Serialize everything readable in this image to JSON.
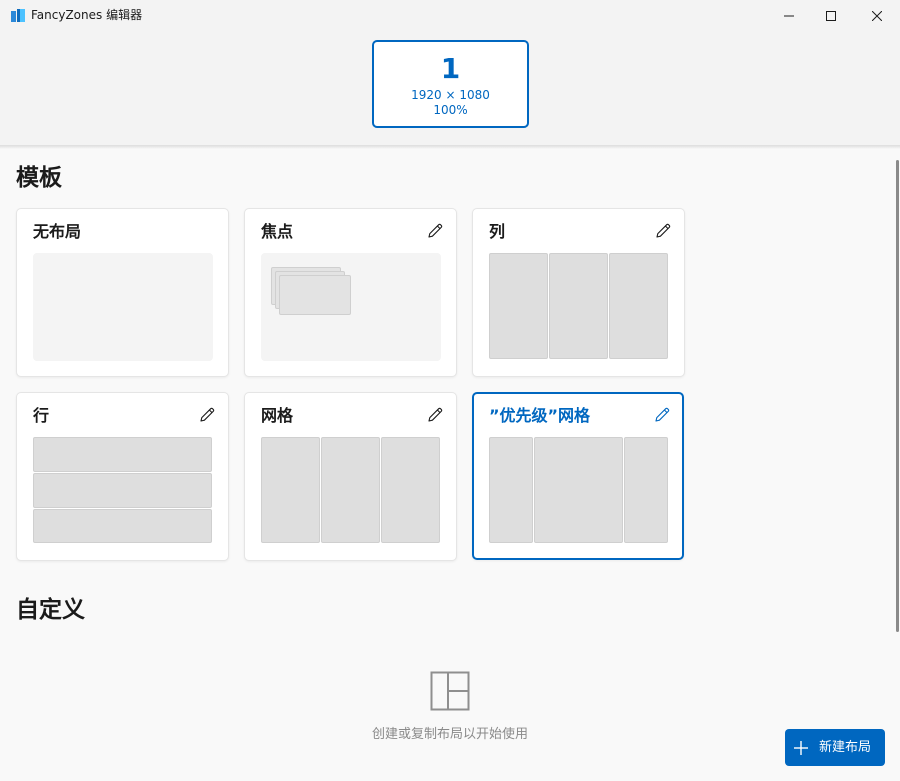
{
  "window": {
    "title": "FancyZones 编辑器"
  },
  "monitor": {
    "number": "1",
    "resolution": "1920 × 1080",
    "scale": "100%"
  },
  "sections": {
    "templates": "模板",
    "custom": "自定义"
  },
  "templates": [
    {
      "name": "无布局",
      "editable": false
    },
    {
      "name": "焦点",
      "editable": true
    },
    {
      "name": "列",
      "editable": true
    },
    {
      "name": "行",
      "editable": true
    },
    {
      "name": "网格",
      "editable": true
    },
    {
      "name": "”优先级”网格",
      "editable": true,
      "selected": true
    }
  ],
  "custom": {
    "empty_text": "创建或复制布局以开始使用",
    "new_layout_label": "新建布局"
  },
  "colors": {
    "accent": "#0067c0",
    "zone": "#dedede",
    "background": "#f9f9f9"
  }
}
